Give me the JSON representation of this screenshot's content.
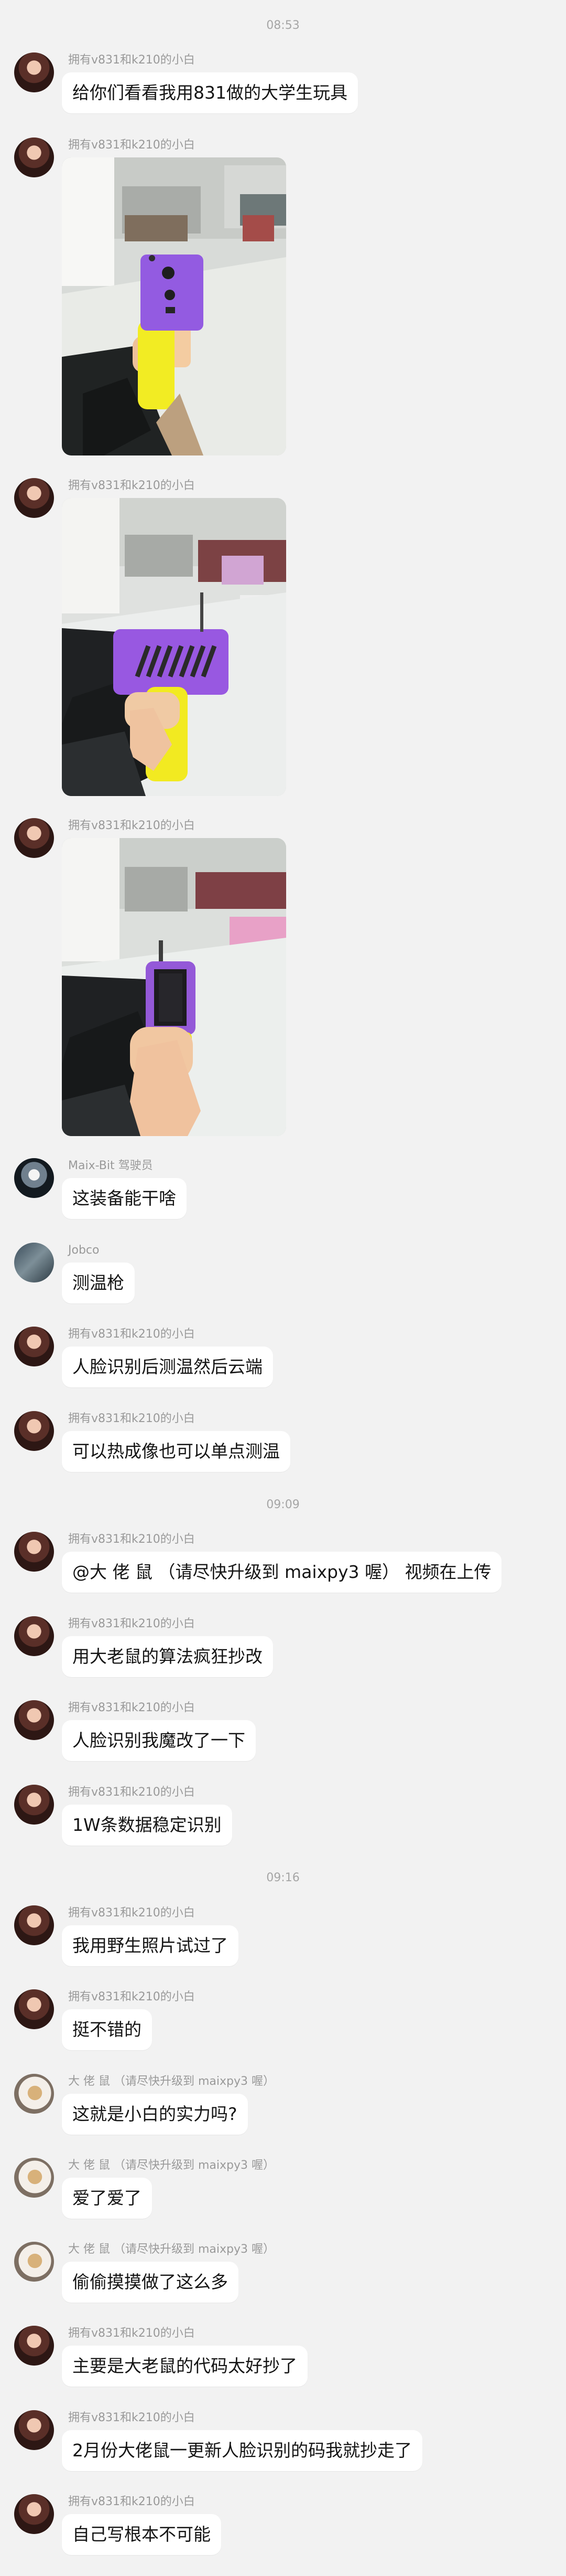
{
  "timestamps": [
    "08:53",
    "09:09",
    "09:16"
  ],
  "messages": [
    {
      "sender": "拥有v831和k210的小白",
      "text": "给你们看看我用831做的大学生玩具"
    },
    {
      "sender": "拥有v831和k210的小白",
      "image": "device-photo-front"
    },
    {
      "sender": "拥有v831和k210的小白",
      "image": "device-photo-side"
    },
    {
      "sender": "拥有v831和k210的小白",
      "image": "device-photo-screen"
    },
    {
      "sender": "Maix-Bit 驾驶员",
      "text": "这装备能干啥"
    },
    {
      "sender": "Jobco",
      "text": "测温枪"
    },
    {
      "sender": "拥有v831和k210的小白",
      "text": "人脸识别后测温然后云端"
    },
    {
      "sender": "拥有v831和k210的小白",
      "text": "可以热成像也可以单点测温"
    },
    {
      "sender": "拥有v831和k210的小白",
      "text": "@大 佬 鼠 （请尽快升级到 maixpy3 喔） 视频在上传"
    },
    {
      "sender": "拥有v831和k210的小白",
      "text": "用大老鼠的算法疯狂抄改"
    },
    {
      "sender": "拥有v831和k210的小白",
      "text": "人脸识别我魔改了一下"
    },
    {
      "sender": "拥有v831和k210的小白",
      "text": "1W条数据稳定识别"
    },
    {
      "sender": "拥有v831和k210的小白",
      "text": "我用野生照片试过了"
    },
    {
      "sender": "拥有v831和k210的小白",
      "text": "挺不错的"
    },
    {
      "sender": "大 佬 鼠 （请尽快升级到 maixpy3 喔）",
      "text": "这就是小白的实力吗?"
    },
    {
      "sender": "大 佬 鼠 （请尽快升级到 maixpy3 喔）",
      "text": "爱了爱了"
    },
    {
      "sender": "大 佬 鼠 （请尽快升级到 maixpy3 喔）",
      "text": "偷偷摸摸做了这么多"
    },
    {
      "sender": "拥有v831和k210的小白",
      "text": "主要是大老鼠的代码太好抄了"
    },
    {
      "sender": "拥有v831和k210的小白",
      "text": "2月份大佬鼠一更新人脸识别的码我就抄走了"
    },
    {
      "sender": "拥有v831和k210的小白",
      "text": "自己写根本不可能"
    }
  ]
}
